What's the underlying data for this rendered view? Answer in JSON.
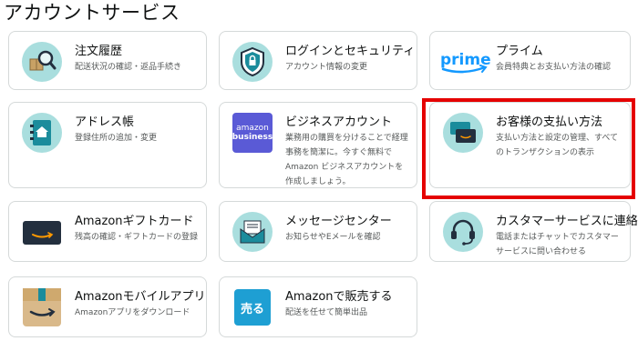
{
  "page": {
    "title": "アカウントサービス"
  },
  "cards": [
    {
      "title": "注文履歴",
      "desc": "配送状況の確認・返品手続き",
      "icon": "package-search-icon"
    },
    {
      "title": "ログインとセキュリティ",
      "desc": "アカウント情報の変更",
      "icon": "shield-lock-icon"
    },
    {
      "title": "プライム",
      "desc": "会員特典とお支払い方法の確認",
      "icon": "prime-logo-icon",
      "logo_text": "prime"
    },
    {
      "title": "アドレス帳",
      "desc": "登録住所の追加・変更",
      "icon": "address-book-icon"
    },
    {
      "title": "ビジネスアカウント",
      "desc": "業務用の購買を分けることで経理\n事務を簡潔に。今すぐ無料で\nAmazon ビジネスアカウントを\n作成しましょう。",
      "icon": "amazon-business-icon",
      "logo_line1": "amazon",
      "logo_line2": "business"
    },
    {
      "title": "お客様の支払い方法",
      "desc": "支払い方法と設定の管理、すべて\nのトランザクションの表示",
      "icon": "payment-cards-icon"
    },
    {
      "title": "Amazonギフトカード",
      "desc": "残高の確認・ギフトカードの登録",
      "icon": "gift-card-icon"
    },
    {
      "title": "メッセージセンター",
      "desc": "お知らせやEメールを確認",
      "icon": "envelope-icon"
    },
    {
      "title": "カスタマーサービスに連絡",
      "desc": "電話またはチャットでカスタマー\nサービスに問い合わせる",
      "icon": "headset-icon"
    },
    {
      "title": "Amazonモバイルアプリ",
      "desc": "Amazonアプリをダウンロード",
      "icon": "amazon-app-icon"
    },
    {
      "title": "Amazonで販売する",
      "desc": "配送を任せて簡単出品",
      "icon": "sell-on-amazon-icon",
      "logo_text": "売る"
    }
  ],
  "colors": {
    "accent": "#a9dede",
    "highlight": "#e50000",
    "prime": "#1399ff",
    "business": "#5a5ad6",
    "sell": "#1e9fd3"
  }
}
